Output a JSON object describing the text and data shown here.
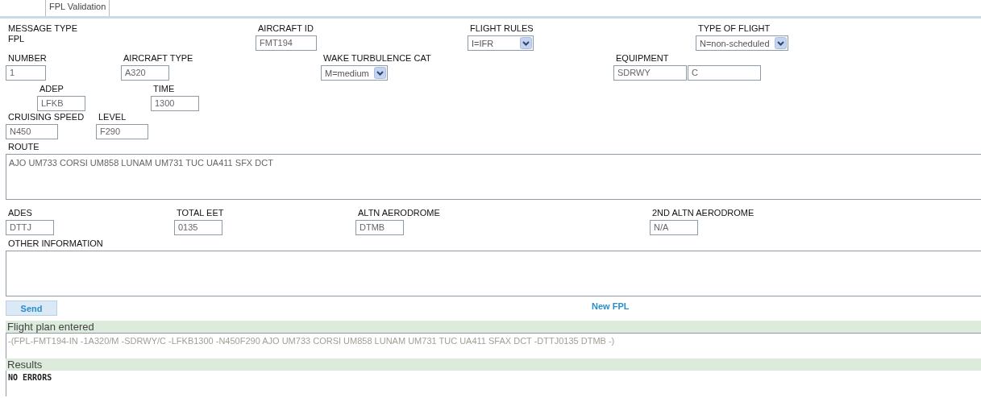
{
  "tab": {
    "label": "FPL Validation",
    "selected": true
  },
  "rows": [
    [
      {
        "kind": "static",
        "label": "MESSAGE TYPE",
        "value": "FPL"
      },
      {
        "kind": "input",
        "label": "AIRCRAFT ID",
        "value": "FMT194"
      },
      {
        "kind": "select",
        "label": "FLIGHT RULES",
        "value": "I=IFR"
      },
      {
        "kind": "select",
        "label": "TYPE OF FLIGHT",
        "value": "N=non-scheduled"
      }
    ],
    [
      {
        "kind": "input",
        "label": "NUMBER",
        "value": "1"
      },
      {
        "kind": "input",
        "label": "AIRCRAFT TYPE",
        "value": "A320"
      },
      {
        "kind": "select",
        "label": "WAKE TURBULENCE CAT",
        "value": "M=medium"
      },
      {
        "kind": "pair",
        "label": "EQUIPMENT",
        "values": [
          "SDRWY",
          "C"
        ]
      }
    ],
    [
      {
        "kind": "input",
        "label": "ADEP",
        "value": "LFKB"
      },
      {
        "kind": "input",
        "label": "TIME",
        "value": "1300"
      }
    ],
    [
      {
        "kind": "input",
        "label": "CRUISING SPEED",
        "value": "N450"
      },
      {
        "kind": "input",
        "label": "LEVEL",
        "value": "F290"
      }
    ]
  ],
  "route": {
    "label": "ROUTE",
    "value": "AJO UM733 CORSI UM858 LUNAM UM731 TUC UA411 SFX DCT"
  },
  "destination_row": [
    {
      "kind": "input",
      "label": "ADES",
      "value": "DTTJ"
    },
    {
      "kind": "input",
      "label": "TOTAL EET",
      "value": "0135"
    },
    {
      "kind": "input",
      "label": "ALTN AERODROME",
      "value": "DTMB"
    },
    {
      "kind": "input",
      "label": "2ND ALTN AERODROME",
      "value": "N/A"
    }
  ],
  "other_information": {
    "label": "OTHER INFORMATION"
  },
  "send_button": "Send",
  "new_fpl_link": "New FPL",
  "flight_plan_entered": {
    "title": "Flight plan entered",
    "text": "-(FPL-FMT194-IN -1A320/M -SDRWY/C -LFKB1300 -N450F290  AJO UM733 CORSI UM858 LUNAM UM731 TUC UA411 SFAX DCT -DTTJ0135 DTMB -)"
  },
  "results": {
    "title": "Results",
    "text": "NO ERRORS"
  }
}
